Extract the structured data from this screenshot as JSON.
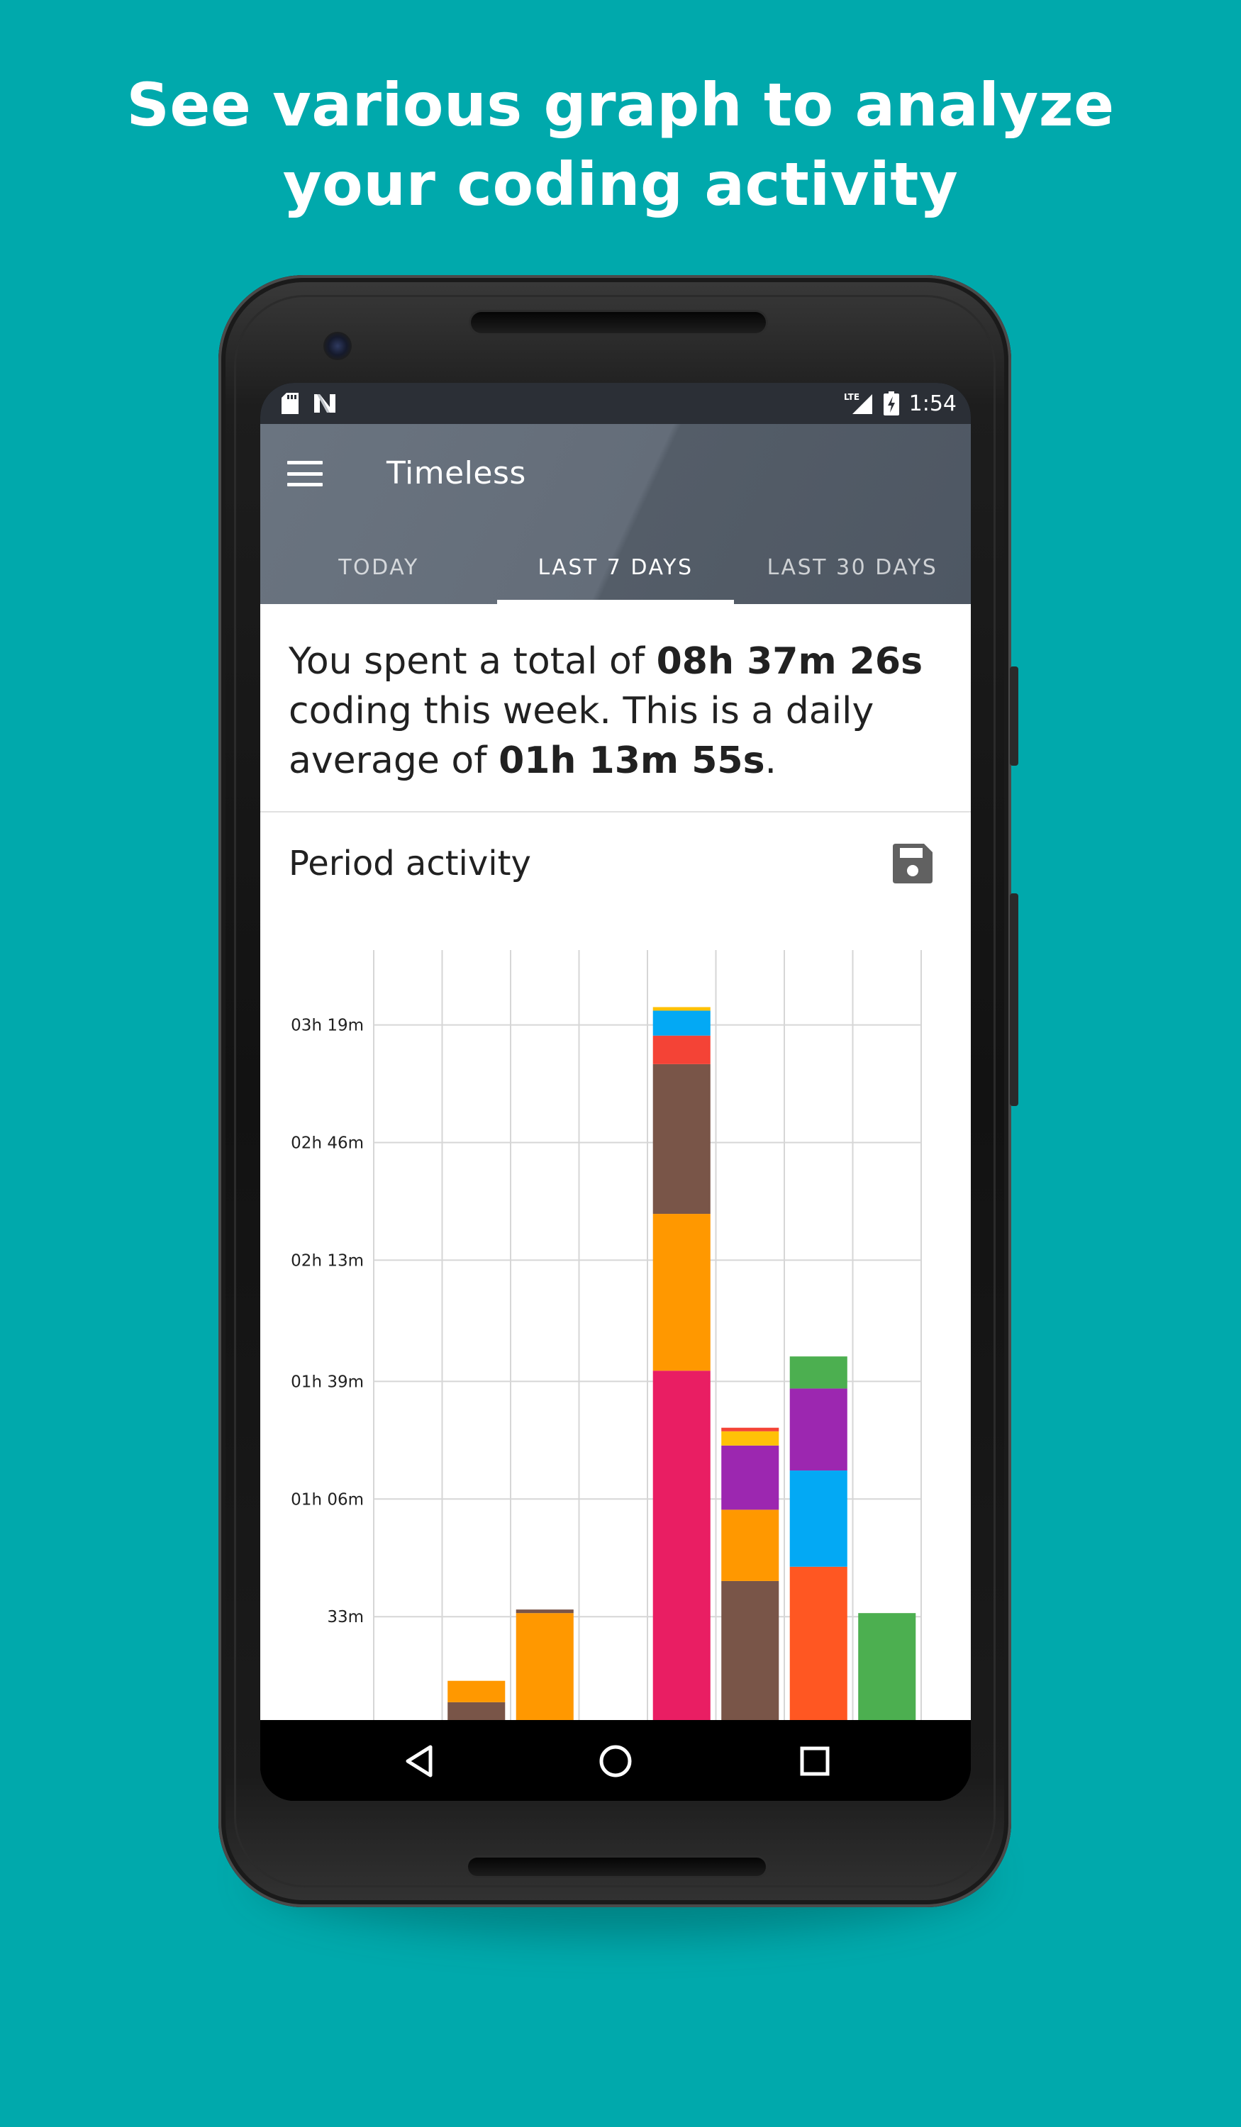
{
  "promo": {
    "line1": "See various graph to analyze",
    "line2": "your coding activity"
  },
  "status_bar": {
    "left_icons": [
      "sd-card-icon",
      "n-icon"
    ],
    "network_label": "LTE",
    "time": "1:54",
    "right_icons": [
      "signal-icon",
      "battery-charging-icon"
    ]
  },
  "app": {
    "title": "Timeless",
    "menu_icon": "hamburger-menu-icon",
    "tabs": [
      {
        "label": "TODAY",
        "active": false
      },
      {
        "label": "LAST 7 DAYS",
        "active": true
      },
      {
        "label": "LAST 30 DAYS",
        "active": false
      }
    ]
  },
  "summary": {
    "part1": "You spent a total of ",
    "total": "08h 37m 26s",
    "part2": " coding this week. This is a daily average of ",
    "average": "01h 13m 55s",
    "part3": "."
  },
  "section": {
    "title": "Period activity",
    "action_icon": "save-icon"
  },
  "chart_data": {
    "type": "bar",
    "stacked": true,
    "title": "",
    "xlabel": "",
    "ylabel": "",
    "grid": true,
    "ytick_labels": [
      "33m",
      "01h 06m",
      "01h 39m",
      "02h 13m",
      "02h 46m",
      "03h 19m"
    ],
    "ytick_values": [
      33,
      66,
      99,
      133,
      166,
      199
    ],
    "ylim": [
      0,
      220
    ],
    "visible_ymin": 4,
    "categories": [
      "",
      "",
      "",
      "",
      "",
      "",
      "",
      ""
    ],
    "series": [
      {
        "color": "#795548",
        "values": [
          0,
          9,
          0,
          4,
          0,
          43,
          0,
          0
        ]
      },
      {
        "color": "#E91E63",
        "values": [
          0,
          0,
          0,
          0,
          102,
          0,
          0,
          0
        ]
      },
      {
        "color": "#FF5722",
        "values": [
          0,
          0,
          0,
          0,
          0,
          0,
          47,
          0
        ]
      },
      {
        "color": "#FF9800",
        "values": [
          0,
          6,
          34,
          0,
          44,
          20,
          0,
          0
        ]
      },
      {
        "color": "#795548",
        "values": [
          0,
          0,
          1,
          0,
          42,
          0,
          0,
          0
        ]
      },
      {
        "color": "#03A9F4",
        "values": [
          0,
          0,
          0,
          0,
          0,
          0,
          27,
          0
        ]
      },
      {
        "color": "#9C27B0",
        "values": [
          0,
          0,
          0,
          0,
          0,
          18,
          23,
          0
        ]
      },
      {
        "color": "#F44336",
        "values": [
          0,
          0,
          0,
          0,
          8,
          0,
          0,
          0
        ]
      },
      {
        "color": "#03A9F4",
        "values": [
          0,
          0,
          0,
          0,
          7,
          0,
          0,
          0
        ]
      },
      {
        "color": "#FFC107",
        "values": [
          0,
          0,
          0,
          0,
          1,
          4,
          0,
          0
        ]
      },
      {
        "color": "#F44336",
        "values": [
          0,
          0,
          0,
          0,
          0,
          1,
          0,
          0
        ]
      },
      {
        "color": "#4CAF50",
        "values": [
          0,
          0,
          0,
          0,
          0,
          0,
          9,
          34
        ]
      }
    ]
  },
  "nav_bar": {
    "back_icon": "back-triangle-icon",
    "home_icon": "home-circle-icon",
    "recents_icon": "recents-square-icon"
  },
  "colors": {
    "background": "#00A9AC",
    "appbar": "#5F6875",
    "statusbar": "#2B2F36",
    "text_primary": "#212121"
  }
}
